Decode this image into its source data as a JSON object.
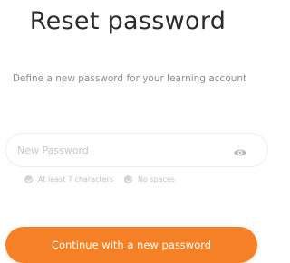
{
  "page": {
    "title": "Reset password",
    "subtitle": "Define a new password for your learning account"
  },
  "password_field": {
    "placeholder": "New Password",
    "value": "",
    "toggle_icon": "eye-icon"
  },
  "rules": [
    {
      "label": "At least 7 characters",
      "icon": "check-circle-icon"
    },
    {
      "label": "No spaces",
      "icon": "check-circle-icon"
    }
  ],
  "submit": {
    "label": "Continue with a new password"
  },
  "colors": {
    "accent": "#f58025",
    "title_text": "#2b2b2b",
    "muted_text": "#8c8c96",
    "rule_text": "#c2c2c8"
  }
}
